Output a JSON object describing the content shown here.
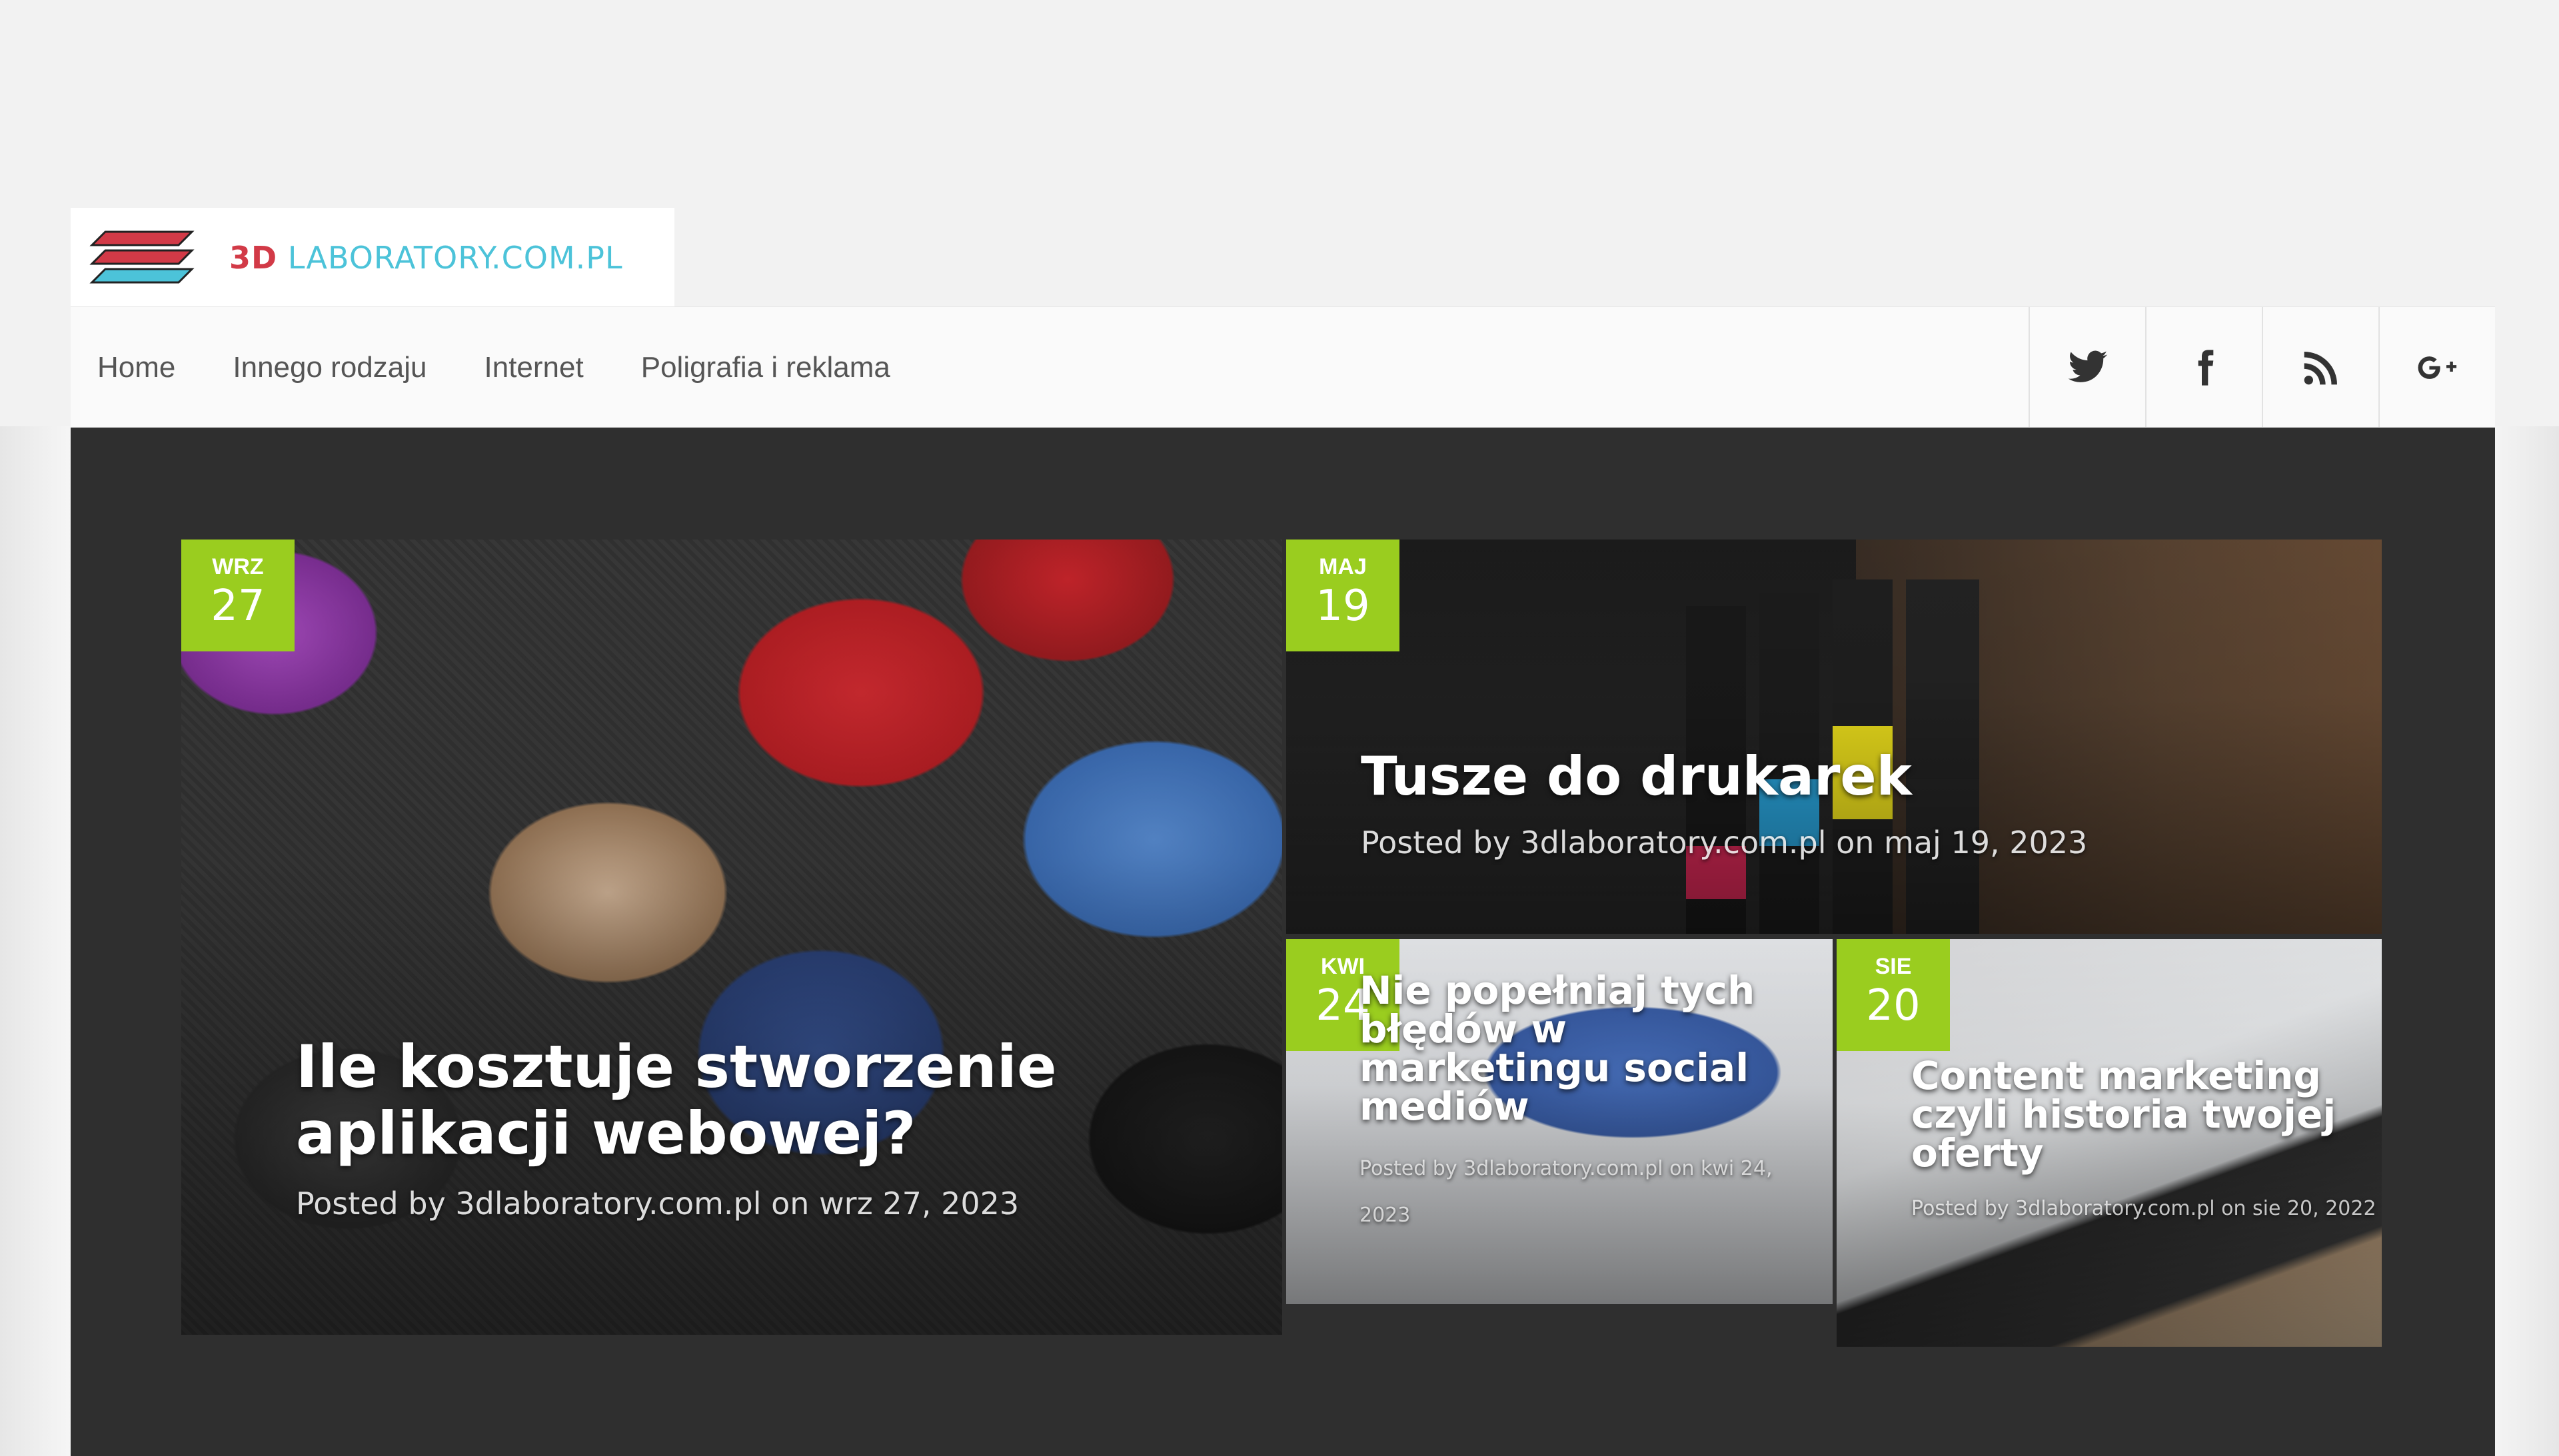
{
  "logo": {
    "prefix": "3D",
    "name": "LABORATORY.COM.PL",
    "colors": {
      "prefix": "#d23a47",
      "name": "#4cc3d9"
    }
  },
  "nav": {
    "items": [
      {
        "label": "Home"
      },
      {
        "label": "Innego rodzaju"
      },
      {
        "label": "Internet"
      },
      {
        "label": "Poligrafia i reklama"
      }
    ]
  },
  "social": {
    "items": [
      {
        "icon": "twitter-icon"
      },
      {
        "icon": "facebook-icon"
      },
      {
        "icon": "rss-icon"
      },
      {
        "icon": "google-plus-icon"
      }
    ]
  },
  "accent_color": "#9acd1f",
  "posts": [
    {
      "month": "WRZ",
      "day": "27",
      "title": "Ile kosztuje stworzenie aplikacji webowej?",
      "meta": "Posted by 3dlaboratory.com.pl on wrz 27, 2023"
    },
    {
      "month": "MAJ",
      "day": "19",
      "title": "Tusze do drukarek",
      "meta": "Posted by 3dlaboratory.com.pl on maj 19, 2023"
    },
    {
      "month": "KWI",
      "day": "24",
      "title": "Nie popełniaj tych błędów w marketingu social mediów",
      "meta": "Posted by 3dlaboratory.com.pl on kwi 24, 2023"
    },
    {
      "month": "SIE",
      "day": "20",
      "title": "Content marketing czyli historia twojej oferty",
      "meta": "Posted by 3dlaboratory.com.pl on sie 20, 2022"
    }
  ]
}
